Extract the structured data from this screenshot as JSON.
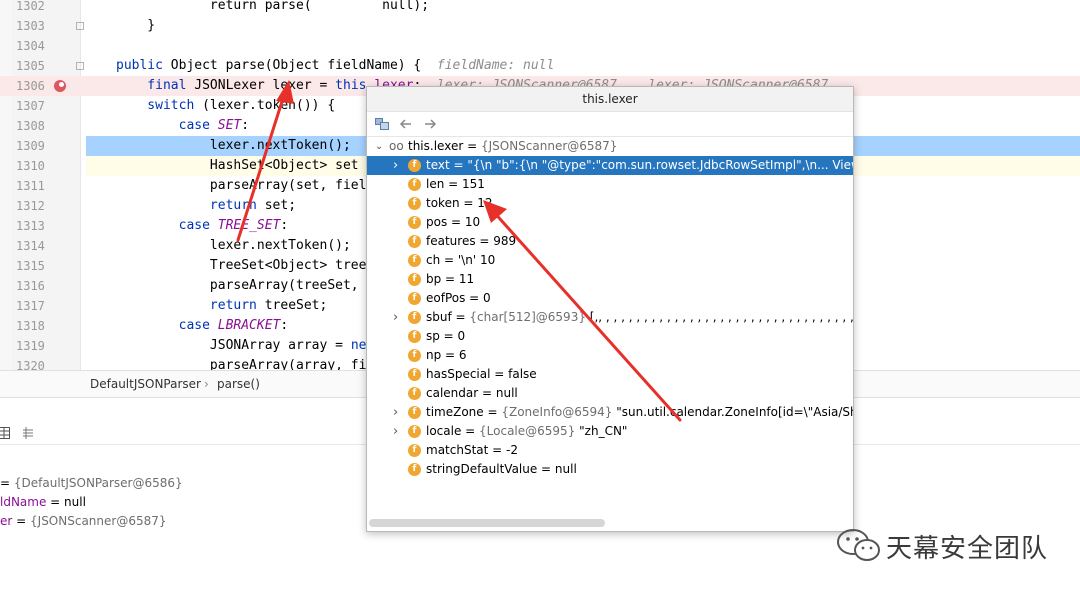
{
  "editor": {
    "lines": [
      {
        "num": "1302",
        "segments": [
          {
            "t": "            return parse(",
            "c": ""
          },
          {
            "t": "        ",
            "c": ""
          },
          {
            "t": " null);",
            "c": ""
          }
        ]
      },
      {
        "num": "1303",
        "segments": [
          {
            "t": "    }",
            "c": ""
          }
        ]
      },
      {
        "num": "1304",
        "segments": [
          {
            "t": "",
            "c": ""
          }
        ]
      },
      {
        "num": "1305",
        "segments": [
          {
            "t": "public ",
            "c": "kw"
          },
          {
            "t": "Object parse(Object fieldName) {  ",
            "c": ""
          },
          {
            "t": "fieldName: null",
            "c": "hint"
          }
        ]
      },
      {
        "num": "1306",
        "segments": [
          {
            "t": "    final ",
            "c": "kw"
          },
          {
            "t": "JSONLexer lexer = ",
            "c": ""
          },
          {
            "t": "this",
            "c": "kw"
          },
          {
            "t": ".",
            "c": ""
          },
          {
            "t": "lexer",
            "c": "fld"
          },
          {
            "t": ";  ",
            "c": ""
          },
          {
            "t": "lexer: JSONScanner@6587    lexer: JSONScanner@6587",
            "c": "hint"
          }
        ]
      },
      {
        "num": "1307",
        "segments": [
          {
            "t": "    switch ",
            "c": "kw"
          },
          {
            "t": "(lexer.token()) {",
            "c": ""
          }
        ]
      },
      {
        "num": "1308",
        "segments": [
          {
            "t": "        case ",
            "c": "kw"
          },
          {
            "t": "SET",
            "c": "it"
          },
          {
            "t": ":",
            "c": ""
          }
        ]
      },
      {
        "num": "1309",
        "segments": [
          {
            "t": "            lexer.nextToken();",
            "c": ""
          }
        ]
      },
      {
        "num": "1310",
        "segments": [
          {
            "t": "            HashSet<Object> set = ",
            "c": ""
          }
        ]
      },
      {
        "num": "1311",
        "segments": [
          {
            "t": "            parseArray(set, field",
            "c": ""
          }
        ]
      },
      {
        "num": "1312",
        "segments": [
          {
            "t": "            return ",
            "c": "kw"
          },
          {
            "t": "set;",
            "c": ""
          }
        ]
      },
      {
        "num": "1313",
        "segments": [
          {
            "t": "        case ",
            "c": "kw"
          },
          {
            "t": "TREE_SET",
            "c": "it"
          },
          {
            "t": ":",
            "c": ""
          }
        ]
      },
      {
        "num": "1314",
        "segments": [
          {
            "t": "            lexer.nextToken();",
            "c": ""
          }
        ]
      },
      {
        "num": "1315",
        "segments": [
          {
            "t": "            TreeSet<Object> treeS",
            "c": ""
          }
        ]
      },
      {
        "num": "1316",
        "segments": [
          {
            "t": "            parseArray(treeSet, f",
            "c": ""
          }
        ]
      },
      {
        "num": "1317",
        "segments": [
          {
            "t": "            return ",
            "c": "kw"
          },
          {
            "t": "treeSet;",
            "c": ""
          }
        ]
      },
      {
        "num": "1318",
        "segments": [
          {
            "t": "        case ",
            "c": "kw"
          },
          {
            "t": "LBRACKET",
            "c": "it"
          },
          {
            "t": ":",
            "c": ""
          }
        ]
      },
      {
        "num": "1319",
        "segments": [
          {
            "t": "            JSONArray array = ",
            "c": ""
          },
          {
            "t": "new",
            "c": "kw"
          }
        ]
      },
      {
        "num": "1320",
        "segments": [
          {
            "t": "            parseArray(array, fie",
            "c": ""
          }
        ]
      }
    ]
  },
  "breadcrumb": {
    "class_name": "DefaultJSONParser",
    "separator": "›",
    "method": "parse()"
  },
  "variables": [
    {
      "name": "",
      "rest": "= ",
      "ref": "{DefaultJSONParser@6586}"
    },
    {
      "name": "ldName",
      "rest": " = null",
      "ref": ""
    },
    {
      "name": "er",
      "rest": " = ",
      "ref": "{JSONScanner@6587}"
    }
  ],
  "popup": {
    "title": "this.lexer",
    "root": {
      "label": "this.lexer = ",
      "ref": "{JSONScanner@6587}"
    },
    "fields": [
      {
        "expand": true,
        "label": "text = ",
        "value": "\"{\\n    \"b\":{\\n          \"@type\":\"com.sun.rowset.JdbcRowSetImpl\",\\n... View",
        "ref": "",
        "selected": true
      },
      {
        "expand": false,
        "label": "len = 151",
        "value": "",
        "ref": ""
      },
      {
        "expand": false,
        "label": "token = 12",
        "value": "",
        "ref": ""
      },
      {
        "expand": false,
        "label": "pos = 10",
        "value": "",
        "ref": ""
      },
      {
        "expand": false,
        "label": "features = 989",
        "value": "",
        "ref": ""
      },
      {
        "expand": false,
        "label": "ch = '\\n' 10",
        "value": "",
        "ref": ""
      },
      {
        "expand": false,
        "label": "bp = 11",
        "value": "",
        "ref": ""
      },
      {
        "expand": false,
        "label": "eofPos = 0",
        "value": "",
        "ref": ""
      },
      {
        "expand": true,
        "label": "sbuf = ",
        "value": " [,, , , , , , , , , , , , , , , , , , , , , , , , , , , , , , , , , , , ,",
        "ref": "{char[512]@6593}"
      },
      {
        "expand": false,
        "label": "sp = 0",
        "value": "",
        "ref": ""
      },
      {
        "expand": false,
        "label": "np = 6",
        "value": "",
        "ref": ""
      },
      {
        "expand": false,
        "label": "hasSpecial = false",
        "value": "",
        "ref": ""
      },
      {
        "expand": false,
        "label": "calendar = null",
        "value": "",
        "ref": ""
      },
      {
        "expand": true,
        "label": "timeZone = ",
        "value": " \"sun.util.calendar.ZoneInfo[id=\\\"Asia/Shanghai\\\",",
        "ref": "{ZoneInfo@6594}"
      },
      {
        "expand": true,
        "label": "locale = ",
        "value": " \"zh_CN\"",
        "ref": "{Locale@6595}"
      },
      {
        "expand": false,
        "label": "matchStat = -2",
        "value": "",
        "ref": ""
      },
      {
        "expand": false,
        "label": "stringDefaultValue = null",
        "value": "",
        "ref": ""
      }
    ]
  },
  "watermark": {
    "text": "天幕安全团队"
  },
  "colors": {
    "arrow": "#e8302a",
    "selection": "#2675bf",
    "breakpoint_line": "#fbe8e8",
    "exec_line": "#a6d2ff"
  }
}
